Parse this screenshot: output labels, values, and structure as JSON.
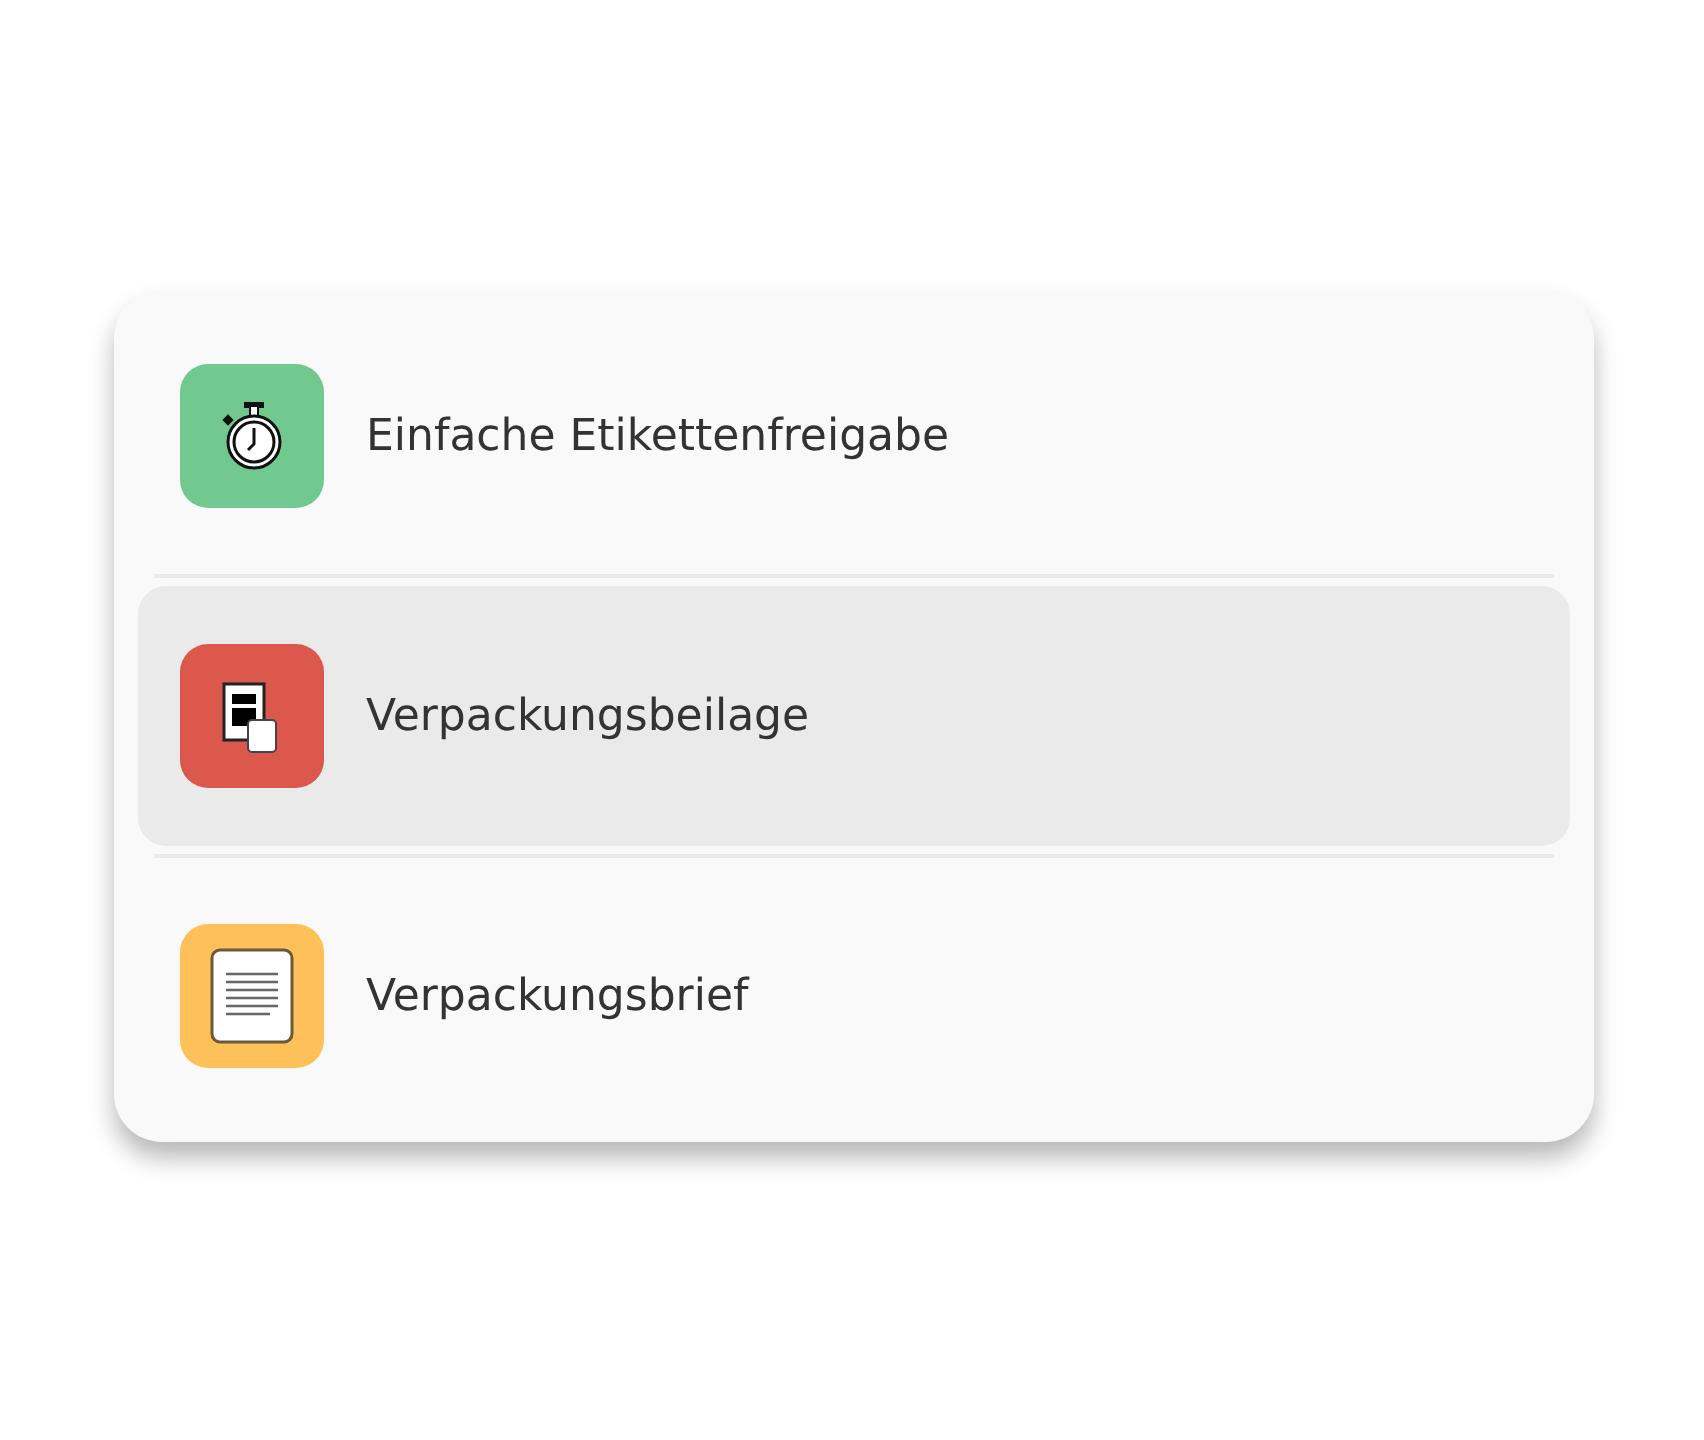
{
  "items": [
    {
      "label": "Einfache Etikettenfreigabe",
      "kind": "stopwatch",
      "color": "#72c98f",
      "selected": false
    },
    {
      "label": "Verpackungsbeilage",
      "kind": "insert",
      "color": "#dc574c",
      "selected": true
    },
    {
      "label": "Verpackungsbrief",
      "kind": "letter",
      "color": "#fec159",
      "selected": false
    }
  ]
}
